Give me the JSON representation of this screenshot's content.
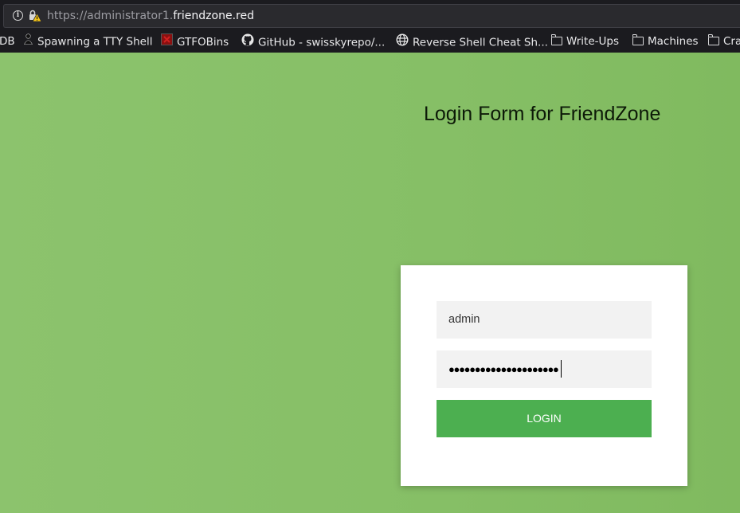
{
  "browser": {
    "url_prefix": "https://administrator1.",
    "url_host": "friendzone.red",
    "bookmarks": [
      {
        "label": "DB",
        "icon": "partial-icon"
      },
      {
        "label": "Spawning a TTY Shell",
        "icon": "dark-figure-icon"
      },
      {
        "label": "GTFOBins",
        "icon": "red-square-icon"
      },
      {
        "label": "GitHub - swisskyrepo/...",
        "icon": "github-icon"
      },
      {
        "label": "Reverse Shell Cheat Sh...",
        "icon": "globe-icon"
      },
      {
        "label": "Write-Ups",
        "icon": "folder-icon"
      },
      {
        "label": "Machines",
        "icon": "folder-icon"
      },
      {
        "label": "Cra",
        "icon": "folder-icon"
      }
    ]
  },
  "page": {
    "title": "Login Form for FriendZone",
    "background_color": "#86bf66"
  },
  "login": {
    "username_value": "admin",
    "password_mask": "●●●●●●●●●●●●●●●●●●●●●",
    "button_label": "LOGIN",
    "button_color": "#4caf50"
  }
}
